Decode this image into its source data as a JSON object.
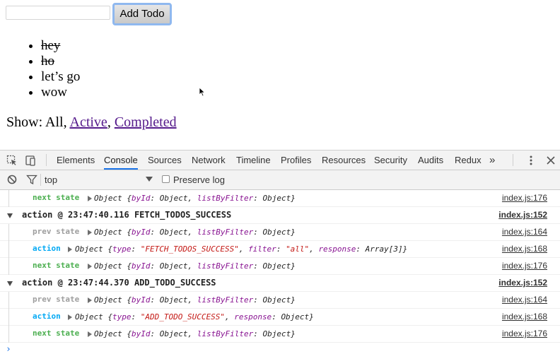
{
  "app": {
    "input_value": "",
    "add_button_label": "Add Todo",
    "todos": [
      {
        "text": "hey",
        "completed": true
      },
      {
        "text": "ho",
        "completed": true
      },
      {
        "text": "let’s go",
        "completed": false
      },
      {
        "text": "wow",
        "completed": false
      }
    ],
    "filter": {
      "prefix": "Show:",
      "all": "All",
      "active": "Active",
      "completed": "Completed",
      "sep": ","
    }
  },
  "devtools": {
    "tabs": [
      "Elements",
      "Console",
      "Sources",
      "Network",
      "Timeline",
      "Profiles",
      "Resources",
      "Security",
      "Audits",
      "Redux"
    ],
    "active_tab": "Console",
    "overflow_glyph": "»",
    "context": "top",
    "preserve_log_label": "Preserve log"
  },
  "console": {
    "partial_first": {
      "label": "next state",
      "text_prefix": "Object {",
      "k1": "byId",
      "v1": "Object",
      "k2": "listByFilter",
      "v2": "Object",
      "src": "index.js:176"
    },
    "groups": [
      {
        "title": "action @ 23:47:40.116 FETCH_TODOS_SUCCESS",
        "src": "index.js:152",
        "prev": {
          "label": "prev state",
          "src": "index.js:164",
          "k1": "byId",
          "v1": "Object",
          "k2": "listByFilter",
          "v2": "Object"
        },
        "action": {
          "label": "action",
          "src": "index.js:168",
          "type": "\"FETCH_TODOS_SUCCESS\"",
          "filter": "\"all\"",
          "response": "Array[3]"
        },
        "next": {
          "label": "next state",
          "src": "index.js:176",
          "k1": "byId",
          "v1": "Object",
          "k2": "listByFilter",
          "v2": "Object"
        }
      },
      {
        "title": "action @ 23:47:44.370 ADD_TODO_SUCCESS",
        "src": "index.js:152",
        "prev": {
          "label": "prev state",
          "src": "index.js:164",
          "k1": "byId",
          "v1": "Object",
          "k2": "listByFilter",
          "v2": "Object"
        },
        "action": {
          "label": "action",
          "src": "index.js:168",
          "type": "\"ADD_TODO_SUCCESS\"",
          "response": "Object"
        },
        "next": {
          "label": "next state",
          "src": "index.js:176",
          "k1": "byId",
          "v1": "Object",
          "k2": "listByFilter",
          "v2": "Object"
        }
      }
    ],
    "prompt": "›"
  }
}
